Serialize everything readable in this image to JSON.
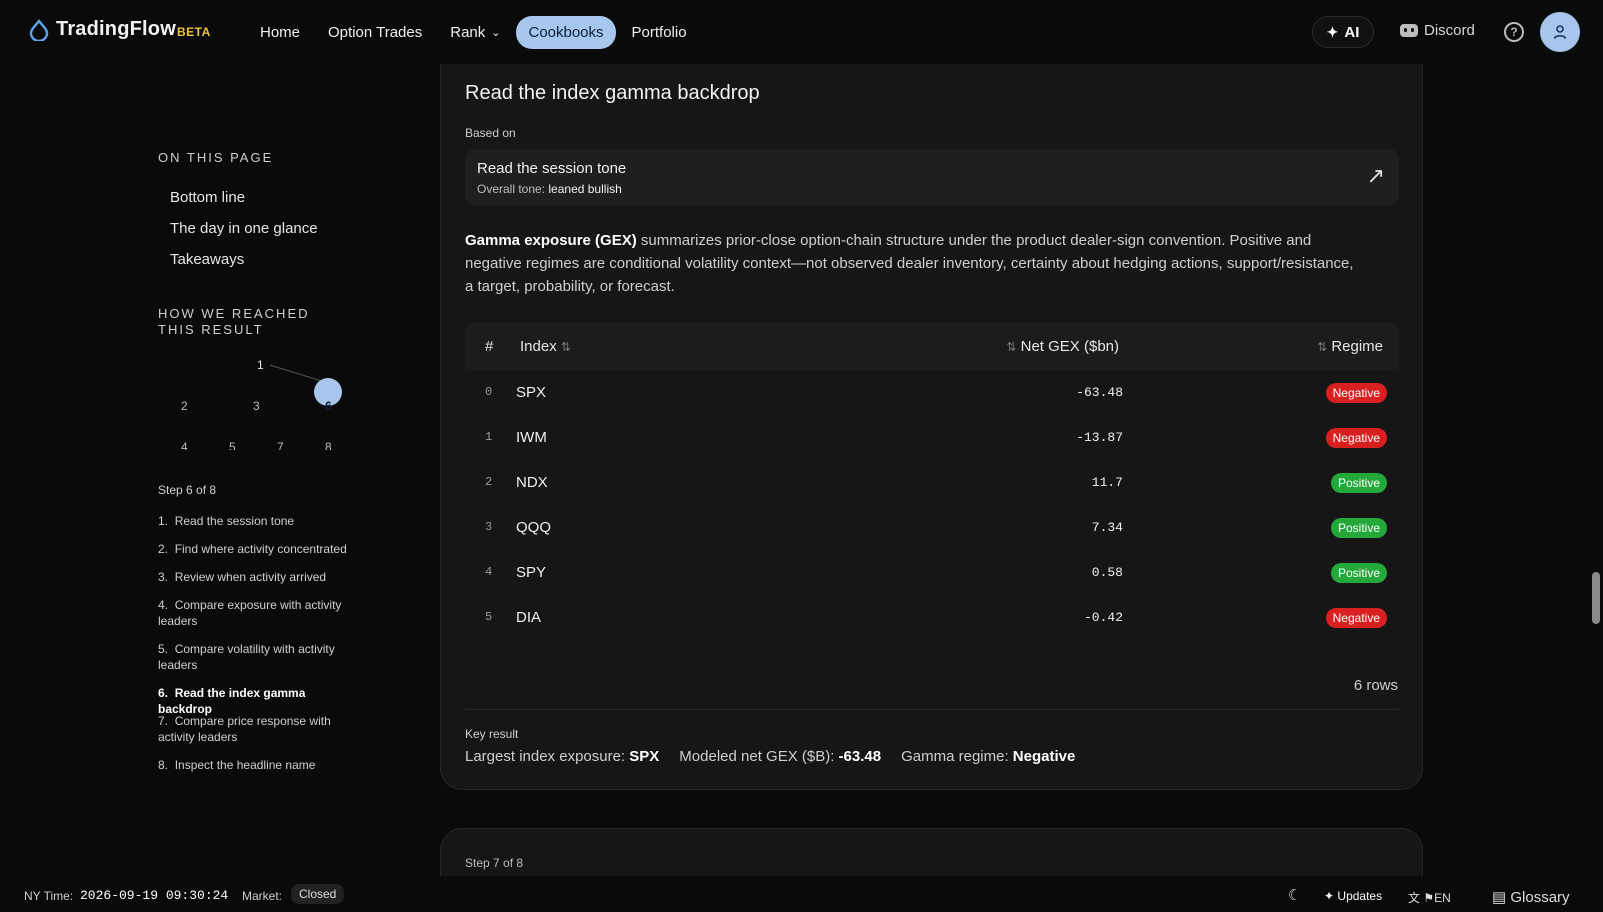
{
  "brand": {
    "name": "TradingFlow",
    "tag": "BETA"
  },
  "nav": {
    "links": [
      {
        "label": "Home",
        "active": false
      },
      {
        "label": "Option Trades",
        "active": false
      },
      {
        "label": "Rank",
        "active": false,
        "dropdown": true
      },
      {
        "label": "Cookbooks",
        "active": true
      },
      {
        "label": "Portfolio",
        "active": false
      }
    ],
    "ai_label": "AI",
    "discord_label": "Discord",
    "help_icon": "help-circle-icon",
    "avatar_icon": "user-icon"
  },
  "sidebar": {
    "on_this_page": "ON THIS PAGE",
    "toc": [
      "Bottom line",
      "The day in one glance",
      "Takeaways"
    ],
    "how_heading": "HOW WE REACHED THIS RESULT",
    "graph_nodes": [
      "1",
      "2",
      "3",
      "6",
      "4",
      "5",
      "7",
      "8"
    ],
    "step_of": "Step 6 of 8",
    "steps": [
      {
        "num": "1.",
        "label": "Read the session tone",
        "current": false
      },
      {
        "num": "2.",
        "label": "Find where activity concentrated",
        "current": false
      },
      {
        "num": "3.",
        "label": "Review when activity arrived",
        "current": false
      },
      {
        "num": "4.",
        "label": "Compare exposure with activity leaders",
        "current": false
      },
      {
        "num": "5.",
        "label": "Compare volatility with activity leaders",
        "current": false
      },
      {
        "num": "6.",
        "label": "Read the index gamma backdrop",
        "current": true
      },
      {
        "num": "7.",
        "label": "Compare price response with activity leaders",
        "current": false
      },
      {
        "num": "8.",
        "label": "Inspect the headline name",
        "current": false
      }
    ]
  },
  "card": {
    "step_label": "Step 6 of 8",
    "title": "Read the index gamma backdrop",
    "based_on_label": "Based on",
    "based_on": {
      "title": "Read the session tone",
      "sub_label": "Overall tone:",
      "sub_value": "leaned bullish",
      "icon": "external-arrow-icon"
    },
    "desc_bold": "Gamma exposure (GEX)",
    "desc_rest": "summarizes prior-close option-chain structure under the product dealer-sign convention. Positive and negative regimes are conditional volatility context—not observed dealer inventory, certainty about hedging actions, support/resistance, a target, probability, or forecast.",
    "table": {
      "headers": {
        "num": "#",
        "index": "Index",
        "gex": "Net GEX ($bn)",
        "regime": "Regime"
      },
      "rows": [
        {
          "num": "0",
          "index": "SPX",
          "gex": "-63.48",
          "regime": "Negative"
        },
        {
          "num": "1",
          "index": "IWM",
          "gex": "-13.87",
          "regime": "Negative"
        },
        {
          "num": "2",
          "index": "NDX",
          "gex": "11.7",
          "regime": "Positive"
        },
        {
          "num": "3",
          "index": "QQQ",
          "gex": "7.34",
          "regime": "Positive"
        },
        {
          "num": "4",
          "index": "SPY",
          "gex": "0.58",
          "regime": "Positive"
        },
        {
          "num": "5",
          "index": "DIA",
          "gex": "-0.42",
          "regime": "Negative"
        }
      ],
      "row_count": "6 rows",
      "colors": {
        "negative": "#d92020",
        "positive": "#25a83a"
      }
    },
    "key_result_label": "Key result",
    "key_results": [
      {
        "label": "Largest index exposure:",
        "value": "SPX"
      },
      {
        "label": "Modeled net GEX ($B):",
        "value": "-63.48"
      },
      {
        "label": "Gamma regime:",
        "value": "Negative"
      }
    ]
  },
  "card2": {
    "step_label": "Step 7 of 8"
  },
  "footer": {
    "ny_label": "NY Time:",
    "ny_value": "2026-09-19 09:30:24",
    "market_label": "Market:",
    "market_value": "Closed",
    "updates": "Updates",
    "lang": "EN",
    "glossary": "Glossary"
  },
  "accent": "#a6c6ec"
}
